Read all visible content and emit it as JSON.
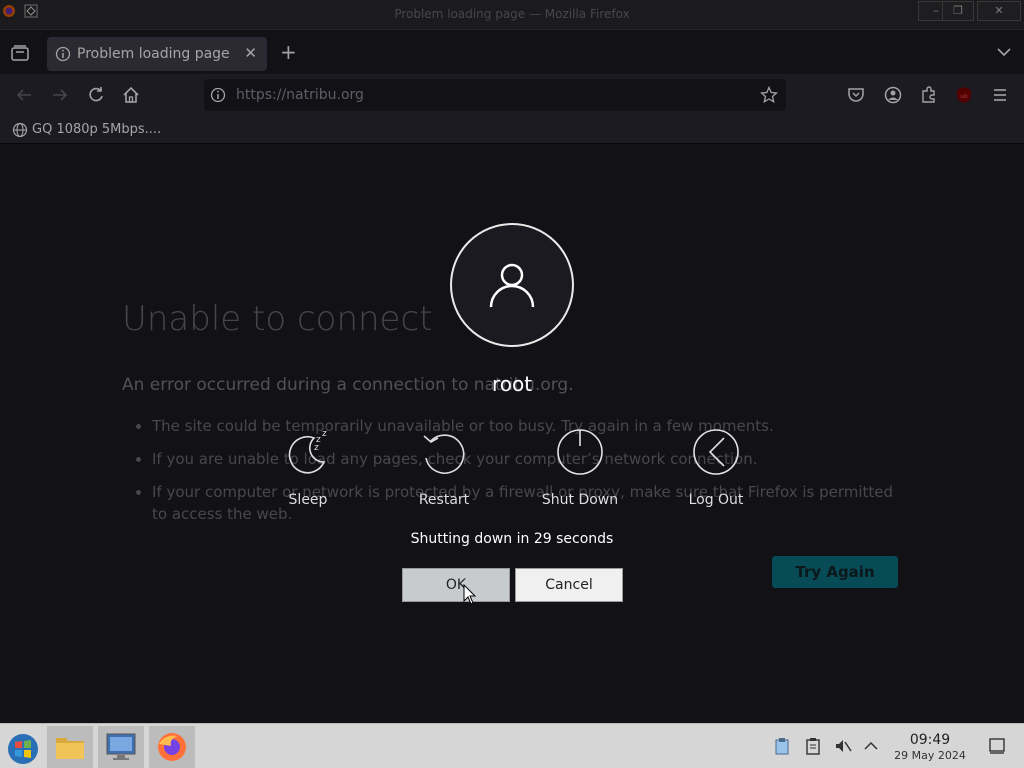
{
  "window": {
    "title": "Problem loading page — Mozilla Firefox",
    "minimize_glyph": "–",
    "maximize_glyph": "❐",
    "close_glyph": "✕"
  },
  "tabs": [
    {
      "label": "Problem loading page",
      "close_glyph": "✕",
      "active": true
    }
  ],
  "new_tab_glyph": "+",
  "navbar": {
    "url": "https://natribu.org"
  },
  "bookmarks": [
    {
      "label": "GQ 1080p 5Mbps...."
    }
  ],
  "error_page": {
    "title": "Unable to connect",
    "description": "An error occurred during a connection to natribu.org.",
    "items": [
      "The site could be temporarily unavailable or too busy. Try again in a few moments.",
      "If you are unable to load any pages, check your computer’s network connection.",
      "If your computer or network is protected by a firewall or proxy, make sure that Firefox is permitted to access the web."
    ],
    "try_again_label": "Try Again"
  },
  "logout_dialog": {
    "user_name": "root",
    "actions": [
      {
        "label": "Sleep",
        "icon": "sleep-icon"
      },
      {
        "label": "Restart",
        "icon": "restart-icon"
      },
      {
        "label": "Shut Down",
        "icon": "power-icon"
      },
      {
        "label": "Log Out",
        "icon": "logout-icon"
      }
    ],
    "countdown": "Shutting down in 29 seconds",
    "ok_label": "OK",
    "cancel_label": "Cancel"
  },
  "taskbar": {
    "time": "09:49",
    "date": "29 May 2024"
  },
  "colors": {
    "accent": "#00bbd4",
    "page_bg": "#1c1b22",
    "toolbar_bg": "#2b2a33",
    "taskbar_bg": "#d6d6d6"
  }
}
